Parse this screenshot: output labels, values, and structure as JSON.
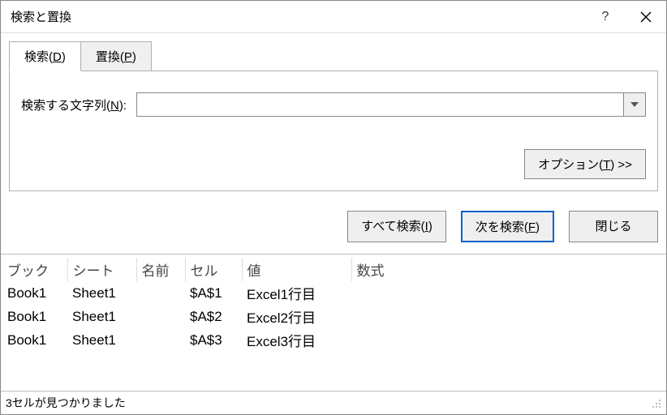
{
  "window": {
    "title": "検索と置換"
  },
  "tabs": {
    "find": {
      "prefix": "検索(",
      "accel": "D",
      "suffix": ")"
    },
    "replace": {
      "prefix": "置換(",
      "accel": "P",
      "suffix": ")"
    }
  },
  "form": {
    "findLabel": {
      "prefix": "検索する文字列(",
      "accel": "N",
      "suffix": "):"
    },
    "findValue": ""
  },
  "buttons": {
    "options": {
      "prefix": "オプション(",
      "accel": "T",
      "suffix": ") >>"
    },
    "findAll": {
      "prefix": "すべて検索(",
      "accel": "I",
      "suffix": ")"
    },
    "findNext": {
      "prefix": "次を検索(",
      "accel": "F",
      "suffix": ")"
    },
    "close": "閉じる"
  },
  "results": {
    "headers": {
      "book": "ブック",
      "sheet": "シート",
      "name": "名前",
      "cell": "セル",
      "value": "値",
      "formula": "数式"
    },
    "rows": [
      {
        "book": "Book1",
        "sheet": "Sheet1",
        "name": "",
        "cell": "$A$1",
        "value": "Excel1行目",
        "formula": ""
      },
      {
        "book": "Book1",
        "sheet": "Sheet1",
        "name": "",
        "cell": "$A$2",
        "value": "Excel2行目",
        "formula": ""
      },
      {
        "book": "Book1",
        "sheet": "Sheet1",
        "name": "",
        "cell": "$A$3",
        "value": "Excel3行目",
        "formula": ""
      }
    ]
  },
  "status": "3セルが見つかりました"
}
